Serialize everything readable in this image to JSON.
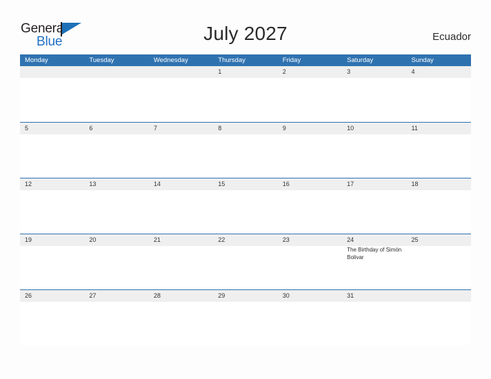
{
  "brand": {
    "name_part1": "General",
    "name_part2": "Blue",
    "flag_icon": "flag-triangle-icon",
    "primary_color": "#1d70b8",
    "text_color": "#231f20"
  },
  "header": {
    "title": "July 2027",
    "country": "Ecuador"
  },
  "calendar": {
    "month": "July",
    "year": "2027",
    "header_bg_color": "#2f72b0",
    "band_bg_color": "#efefef",
    "weekday_headers": [
      "Monday",
      "Tuesday",
      "Wednesday",
      "Thursday",
      "Friday",
      "Saturday",
      "Sunday"
    ],
    "weeks": [
      {
        "days": [
          {
            "num": "",
            "events": []
          },
          {
            "num": "",
            "events": []
          },
          {
            "num": "",
            "events": []
          },
          {
            "num": "1",
            "events": []
          },
          {
            "num": "2",
            "events": []
          },
          {
            "num": "3",
            "events": []
          },
          {
            "num": "4",
            "events": []
          }
        ]
      },
      {
        "days": [
          {
            "num": "5",
            "events": []
          },
          {
            "num": "6",
            "events": []
          },
          {
            "num": "7",
            "events": []
          },
          {
            "num": "8",
            "events": []
          },
          {
            "num": "9",
            "events": []
          },
          {
            "num": "10",
            "events": []
          },
          {
            "num": "11",
            "events": []
          }
        ]
      },
      {
        "days": [
          {
            "num": "12",
            "events": []
          },
          {
            "num": "13",
            "events": []
          },
          {
            "num": "14",
            "events": []
          },
          {
            "num": "15",
            "events": []
          },
          {
            "num": "16",
            "events": []
          },
          {
            "num": "17",
            "events": []
          },
          {
            "num": "18",
            "events": []
          }
        ]
      },
      {
        "days": [
          {
            "num": "19",
            "events": []
          },
          {
            "num": "20",
            "events": []
          },
          {
            "num": "21",
            "events": []
          },
          {
            "num": "22",
            "events": []
          },
          {
            "num": "23",
            "events": []
          },
          {
            "num": "24",
            "events": [
              "The Birthday of Simón Bolivar"
            ]
          },
          {
            "num": "25",
            "events": []
          }
        ]
      },
      {
        "days": [
          {
            "num": "26",
            "events": []
          },
          {
            "num": "27",
            "events": []
          },
          {
            "num": "28",
            "events": []
          },
          {
            "num": "29",
            "events": []
          },
          {
            "num": "30",
            "events": []
          },
          {
            "num": "31",
            "events": []
          },
          {
            "num": "",
            "events": []
          }
        ]
      }
    ]
  }
}
